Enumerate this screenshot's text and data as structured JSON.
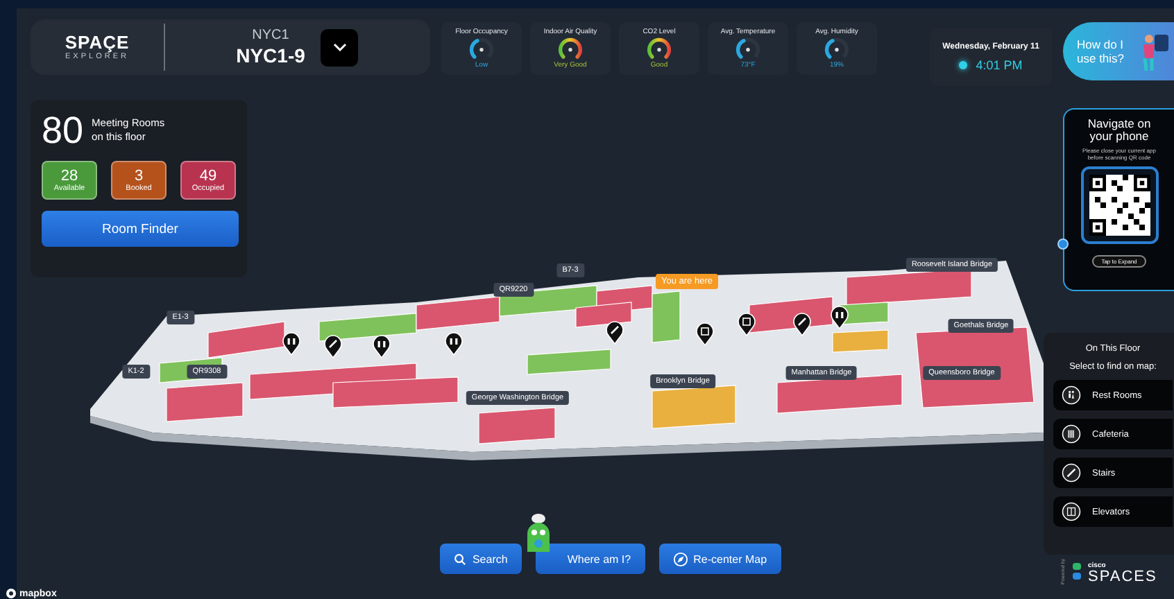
{
  "header": {
    "logo_title": "SPAÇE",
    "logo_subtitle": "EXPLORER",
    "building": "NYC1",
    "floor": "NYC1-9",
    "metrics": [
      {
        "title": "Floor Occupancy",
        "value": "Low",
        "kind": "solid"
      },
      {
        "title": "Indoor Air Quality",
        "value": "Very Good",
        "kind": "rainbow"
      },
      {
        "title": "CO2 Level",
        "value": "Good",
        "kind": "rainbow"
      },
      {
        "title": "Avg. Temperature",
        "value": "73°F",
        "kind": "solid"
      },
      {
        "title": "Avg. Humidity",
        "value": "19%",
        "kind": "solid"
      }
    ],
    "date": "Wednesday, February 11",
    "time": "4:01 PM",
    "help": "How do I use this?"
  },
  "rooms": {
    "total": "80",
    "caption": "Meeting Rooms on this floor",
    "stats": [
      {
        "count": "28",
        "label": "Available",
        "color": "#4a9a3c"
      },
      {
        "count": "3",
        "label": "Booked",
        "color": "#b5521c"
      },
      {
        "count": "49",
        "label": "Occupied",
        "color": "#b8334f"
      }
    ],
    "button": "Room Finder"
  },
  "map": {
    "labels": [
      {
        "text": "You are here",
        "kind": "current"
      },
      {
        "text": "Roosevelt Island Bridge",
        "kind": "room"
      },
      {
        "text": "B7-3",
        "kind": "room"
      },
      {
        "text": "QR9220",
        "kind": "room"
      },
      {
        "text": "E1-3",
        "kind": "room"
      },
      {
        "text": "Goethals Bridge",
        "kind": "room"
      },
      {
        "text": "K1-2",
        "kind": "room"
      },
      {
        "text": "QR9308",
        "kind": "room"
      },
      {
        "text": "Manhattan Bridge",
        "kind": "room"
      },
      {
        "text": "Queensboro Bridge",
        "kind": "room"
      },
      {
        "text": "Brooklyn Bridge",
        "kind": "room"
      },
      {
        "text": "George Washington Bridge",
        "kind": "room"
      }
    ],
    "attribution": "mapbox"
  },
  "qr": {
    "title": "Navigate on your phone",
    "note": "Please close your current app before scanning QR code",
    "button": "Tap to Expand"
  },
  "floor_panel": {
    "title": "On This Floor",
    "subtitle": "Select to find on map:",
    "items": [
      {
        "label": "Rest Rooms",
        "kind": "restroom"
      },
      {
        "label": "Cafeteria",
        "kind": "cafeteria"
      },
      {
        "label": "Stairs",
        "kind": "stairs"
      },
      {
        "label": "Elevators",
        "kind": "elevator"
      }
    ]
  },
  "footer": {
    "powered_by": "Powered by",
    "brand_top": "cisco",
    "brand": "SPACES"
  },
  "actions": [
    {
      "label": "Search",
      "kind": "search"
    },
    {
      "label": "Where am I?",
      "kind": "locate"
    },
    {
      "label": "Re-center Map",
      "kind": "recenter"
    }
  ]
}
